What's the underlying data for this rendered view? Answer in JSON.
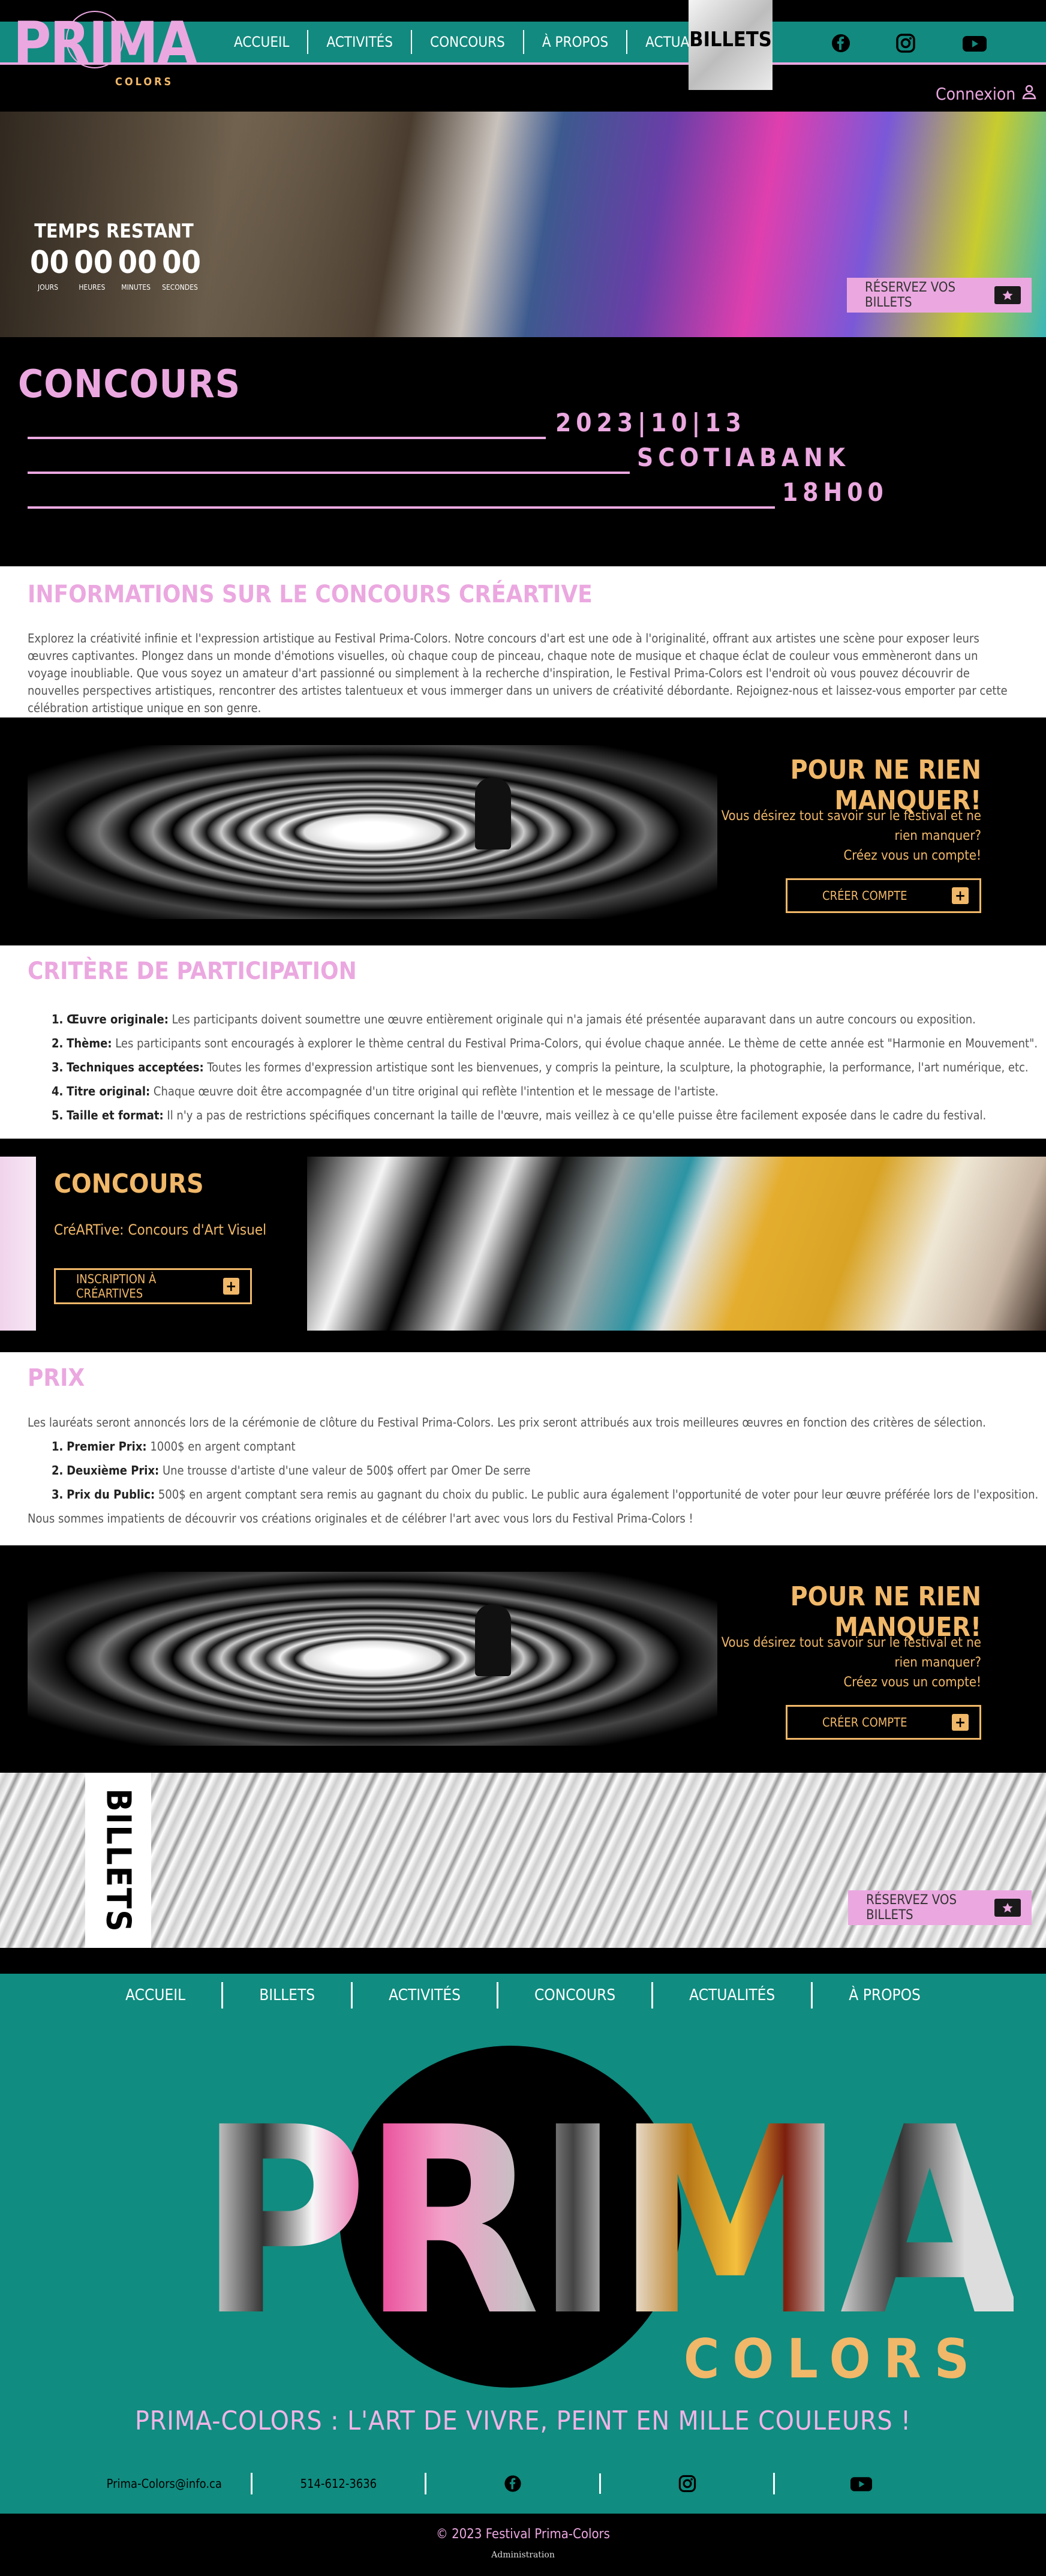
{
  "header": {
    "logo_word": "PRIMA",
    "logo_sub": "COLORS",
    "nav": [
      "ACCUEIL",
      "ACTIVITÉS",
      "CONCOURS",
      "À PROPOS",
      "ACTUALITÉS"
    ],
    "billets_tab": "BILLETS",
    "connexion": "Connexion",
    "social": [
      "facebook-icon",
      "instagram-icon",
      "youtube-icon"
    ]
  },
  "hero": {
    "timer_label": "TEMPS RESTANT",
    "timer": [
      {
        "value": "00",
        "unit": "JOURS"
      },
      {
        "value": "00",
        "unit": "HEURES"
      },
      {
        "value": "00",
        "unit": "MINUTES"
      },
      {
        "value": "00",
        "unit": "SECONDES"
      }
    ],
    "cta": "RÉSERVEZ VOS BILLETS"
  },
  "concours": {
    "title": "CONCOURS",
    "date": "2023|10|13",
    "venue": "SCOTIABANK",
    "time": "18H00"
  },
  "info": {
    "title": "INFORMATIONS SUR LE CONCOURS CRÉARTIVE",
    "text": "Explorez la créativité infinie et l'expression artistique au Festival Prima-Colors. Notre concours d'art est une ode à l'originalité, offrant aux artistes une scène pour exposer leurs œuvres captivantes. Plongez dans un monde d'émotions visuelles, où chaque coup de pinceau, chaque note de musique et chaque éclat de couleur vous emmèneront dans un voyage inoubliable. Que vous soyez un amateur d'art passionné ou simplement à la recherche d'inspiration, le Festival Prima-Colors est l'endroit où vous pouvez découvrir de nouvelles perspectives artistiques, rencontrer des artistes talentueux et vous immerger dans un univers de créativité débordante. Rejoignez-nous et laissez-vous emporter par cette célébration artistique unique en son genre."
  },
  "banner": {
    "title": "POUR NE RIEN MANQUER!",
    "line1": "Vous désirez tout savoir sur le festival et ne rien manquer?",
    "line2": "Créez vous un compte!",
    "button": "CRÉER COMPTE"
  },
  "criteria": {
    "title": "CRITÈRE DE PARTICIPATION",
    "items": [
      {
        "n": "1.",
        "label": "Œuvre originale:",
        "text": " Les participants doivent soumettre une œuvre entièrement originale qui n'a jamais été présentée auparavant dans un autre concours ou exposition."
      },
      {
        "n": "2.",
        "label": "Thème:",
        "text": " Les participants sont encouragés à explorer le thème central du Festival Prima-Colors, qui évolue chaque année. Le thème de cette année est \"Harmonie en Mouvement\"."
      },
      {
        "n": "3.",
        "label": "Techniques acceptées:",
        "text": " Toutes les formes d'expression artistique sont les bienvenues, y compris la peinture, la sculpture, la photographie, la performance, l'art numérique, etc."
      },
      {
        "n": "4.",
        "label": "Titre original:",
        "text": " Chaque œuvre doit être accompagnée d'un titre original qui reflète l'intention et le message de l'artiste."
      },
      {
        "n": "5.",
        "label": "Taille et format:",
        "text": " Il n'y a pas de restrictions spécifiques concernant la taille de l'œuvre, mais veillez à ce qu'elle puisse être facilement exposée dans le cadre du festival."
      }
    ]
  },
  "concours_banner": {
    "title": "CONCOURS",
    "subtitle": "CréARTive: Concours d'Art Visuel",
    "button": "INSCRIPTION À CRÉARTIVES"
  },
  "prix": {
    "title": "PRIX",
    "intro": "Les lauréats seront annoncés lors de la cérémonie de clôture du Festival Prima-Colors. Les prix seront attribués aux trois meilleures œuvres en fonction des critères de sélection.",
    "items": [
      {
        "n": "1.",
        "label": "Premier Prix:",
        "text": " 1000$ en argent comptant"
      },
      {
        "n": "2.",
        "label": "Deuxième Prix:",
        "text": " Une trousse d'artiste d'une valeur de 500$ offert par Omer De serre"
      },
      {
        "n": "3.",
        "label": "Prix du Public:",
        "text": " 500$ en argent comptant sera remis au gagnant du choix du public. Le public aura également l'opportunité de voter pour leur œuvre préférée lors de l'exposition."
      }
    ],
    "outro": "Nous sommes impatients de découvrir vos créations originales et de célébrer l'art avec vous lors du Festival Prima-Colors !"
  },
  "billets_band": {
    "label": "BILLETS",
    "cta": "RÉSERVEZ VOS BILLETS"
  },
  "footer": {
    "nav": [
      "ACCUEIL",
      "BILLETS",
      "ACTIVITÉS",
      "CONCOURS",
      "ACTUALITÉS",
      "À PROPOS"
    ],
    "logo_word": "PRIMA",
    "logo_sub": "COLORS",
    "slogan": "PRIMA-COLORS : L'ART DE VIVRE, PEINT EN MILLE COULEURS !",
    "email": "Prima-Colors@info.ca",
    "phone": "514-612-3636",
    "copyright": "© 2023 Festival Prima-Colors",
    "admin": "Administration"
  },
  "colors": {
    "teal": "#108c80",
    "pink": "#eba8e0",
    "gold": "#f1b869",
    "black": "#000000"
  }
}
